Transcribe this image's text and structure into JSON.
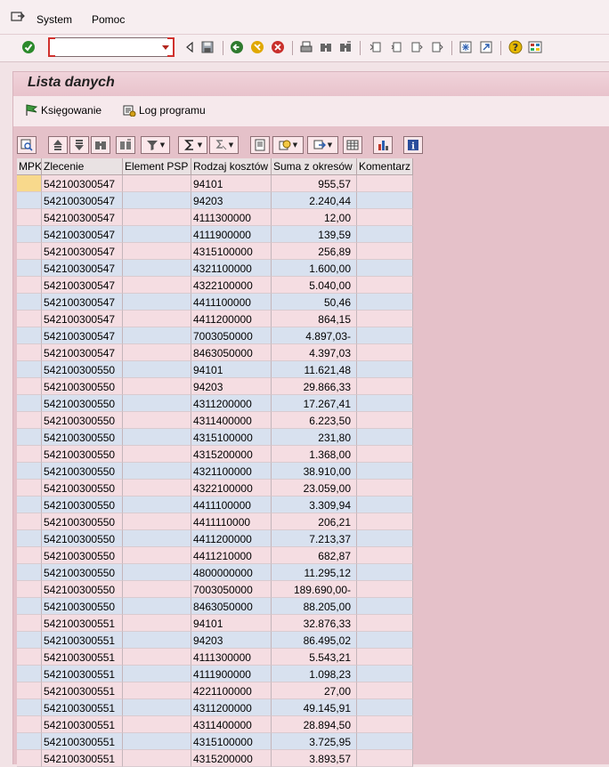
{
  "menu": {
    "items": [
      {
        "name": "system",
        "label": "System"
      },
      {
        "name": "help",
        "label": "Pomoc"
      }
    ]
  },
  "toolbar": {
    "command_value": "",
    "icons": [
      "enter-icon",
      "back-arrow-icon",
      "save-icon",
      "back-icon",
      "exit-icon",
      "cancel-icon",
      "print-icon",
      "find-icon",
      "find-next-icon",
      "first-page-icon",
      "previous-page-icon",
      "next-page-icon",
      "last-page-icon",
      "new-session-icon",
      "shortcut-icon",
      "help-icon",
      "settings-icon"
    ]
  },
  "page": {
    "title": "Lista danych"
  },
  "app_toolbar": {
    "posting_label": "Księgowanie",
    "log_label": "Log programu"
  },
  "grid": {
    "columns": [
      "MPK",
      "Zlecenie",
      "Element PSP",
      "Rodzaj kosztów",
      "Suma z okresów",
      "Komentarz"
    ],
    "rows": [
      [
        "",
        "542100300547",
        "",
        "94101",
        "955,57",
        ""
      ],
      [
        "",
        "542100300547",
        "",
        "94203",
        "2.240,44",
        ""
      ],
      [
        "",
        "542100300547",
        "",
        "4111300000",
        "12,00",
        ""
      ],
      [
        "",
        "542100300547",
        "",
        "4111900000",
        "139,59",
        ""
      ],
      [
        "",
        "542100300547",
        "",
        "4315100000",
        "256,89",
        ""
      ],
      [
        "",
        "542100300547",
        "",
        "4321100000",
        "1.600,00",
        ""
      ],
      [
        "",
        "542100300547",
        "",
        "4322100000",
        "5.040,00",
        ""
      ],
      [
        "",
        "542100300547",
        "",
        "4411100000",
        "50,46",
        ""
      ],
      [
        "",
        "542100300547",
        "",
        "4411200000",
        "864,15",
        ""
      ],
      [
        "",
        "542100300547",
        "",
        "7003050000",
        "4.897,03-",
        ""
      ],
      [
        "",
        "542100300547",
        "",
        "8463050000",
        "4.397,03",
        ""
      ],
      [
        "",
        "542100300550",
        "",
        "94101",
        "11.621,48",
        ""
      ],
      [
        "",
        "542100300550",
        "",
        "94203",
        "29.866,33",
        ""
      ],
      [
        "",
        "542100300550",
        "",
        "4311200000",
        "17.267,41",
        ""
      ],
      [
        "",
        "542100300550",
        "",
        "4311400000",
        "6.223,50",
        ""
      ],
      [
        "",
        "542100300550",
        "",
        "4315100000",
        "231,80",
        ""
      ],
      [
        "",
        "542100300550",
        "",
        "4315200000",
        "1.368,00",
        ""
      ],
      [
        "",
        "542100300550",
        "",
        "4321100000",
        "38.910,00",
        ""
      ],
      [
        "",
        "542100300550",
        "",
        "4322100000",
        "23.059,00",
        ""
      ],
      [
        "",
        "542100300550",
        "",
        "4411100000",
        "3.309,94",
        ""
      ],
      [
        "",
        "542100300550",
        "",
        "4411110000",
        "206,21",
        ""
      ],
      [
        "",
        "542100300550",
        "",
        "4411200000",
        "7.213,37",
        ""
      ],
      [
        "",
        "542100300550",
        "",
        "4411210000",
        "682,87",
        ""
      ],
      [
        "",
        "542100300550",
        "",
        "4800000000",
        "11.295,12",
        ""
      ],
      [
        "",
        "542100300550",
        "",
        "7003050000",
        "189.690,00-",
        ""
      ],
      [
        "",
        "542100300550",
        "",
        "8463050000",
        "88.205,00",
        ""
      ],
      [
        "",
        "542100300551",
        "",
        "94101",
        "32.876,33",
        ""
      ],
      [
        "",
        "542100300551",
        "",
        "94203",
        "86.495,02",
        ""
      ],
      [
        "",
        "542100300551",
        "",
        "4111300000",
        "5.543,21",
        ""
      ],
      [
        "",
        "542100300551",
        "",
        "4111900000",
        "1.098,23",
        ""
      ],
      [
        "",
        "542100300551",
        "",
        "4221100000",
        "27,00",
        ""
      ],
      [
        "",
        "542100300551",
        "",
        "4311200000",
        "49.145,91",
        ""
      ],
      [
        "",
        "542100300551",
        "",
        "4311400000",
        "28.894,50",
        ""
      ],
      [
        "",
        "542100300551",
        "",
        "4315100000",
        "3.725,95",
        ""
      ],
      [
        "",
        "542100300551",
        "",
        "4315200000",
        "3.893,57",
        ""
      ]
    ]
  }
}
